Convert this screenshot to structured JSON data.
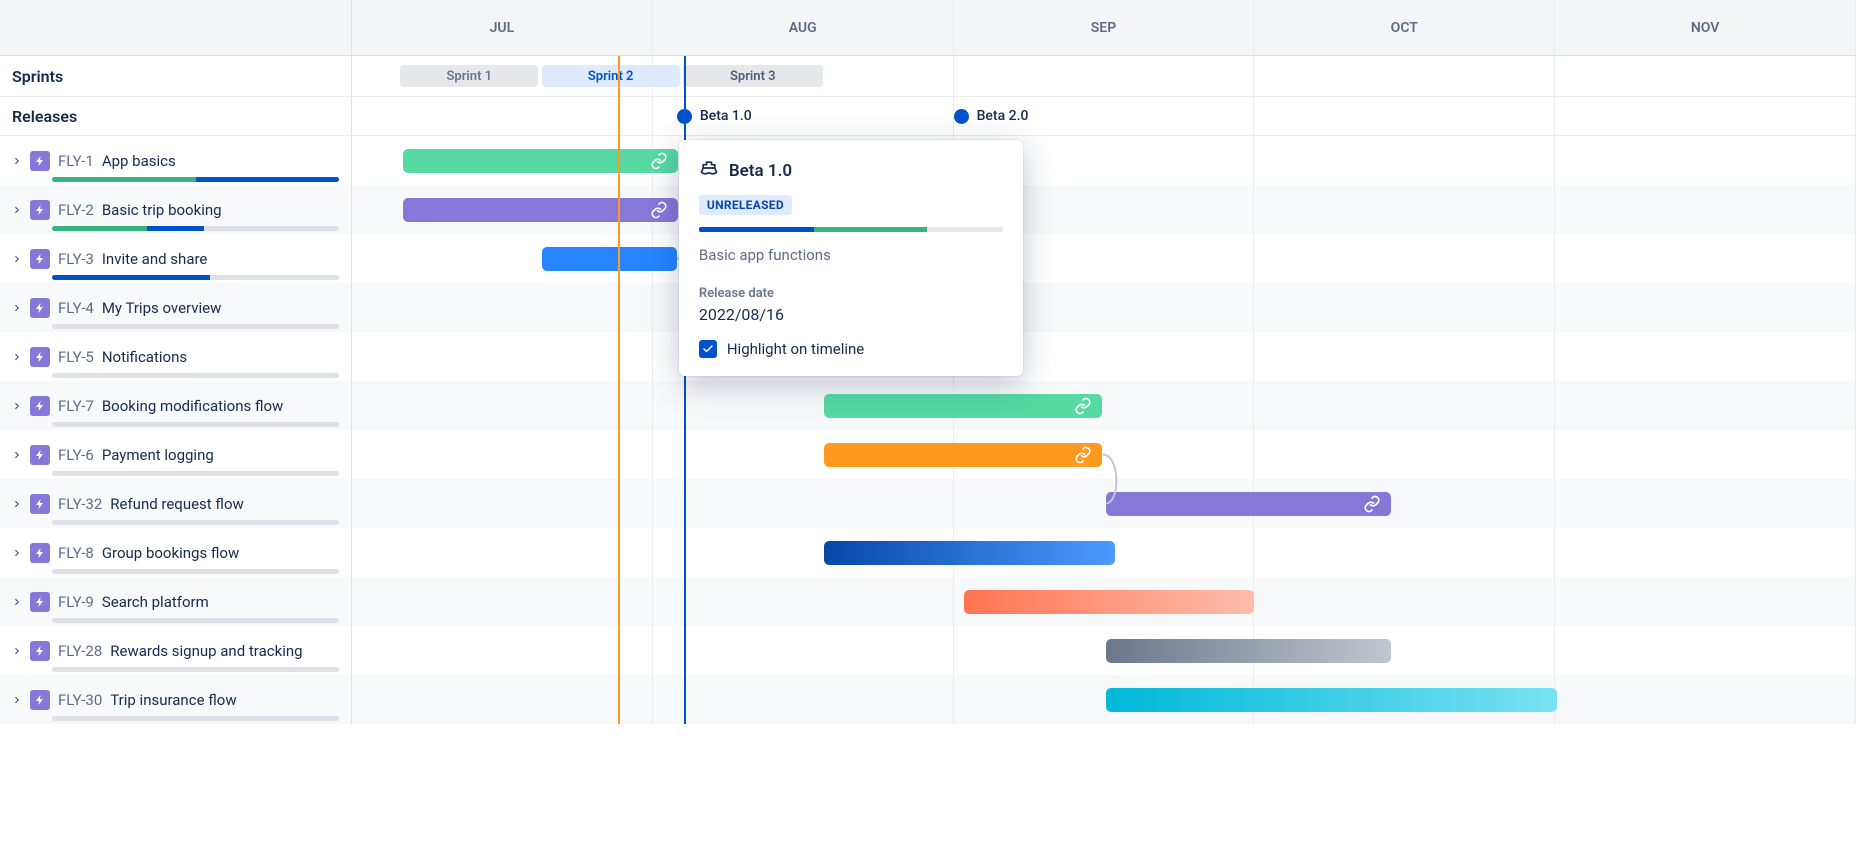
{
  "timeline": {
    "months": [
      "JUL",
      "AUG",
      "SEP",
      "OCT",
      "NOV"
    ]
  },
  "sections": {
    "sprints_label": "Sprints",
    "releases_label": "Releases"
  },
  "sprints": [
    {
      "name": "Sprint 1",
      "left_pct": 3.2,
      "width_pct": 9.2,
      "bg": "#E6E8EB",
      "color": "#6B778C"
    },
    {
      "name": "Sprint 2",
      "left_pct": 12.6,
      "width_pct": 9.2,
      "bg": "#DEEBFF",
      "color": "#0052CC"
    },
    {
      "name": "Sprint 3",
      "left_pct": 22.0,
      "width_pct": 9.3,
      "bg": "#E6E8EB",
      "color": "#505F79"
    }
  ],
  "releases": [
    {
      "name": "Beta 1.0",
      "left_pct": 21.6
    },
    {
      "name": "Beta 2.0",
      "left_pct": 40.0
    }
  ],
  "issues": [
    {
      "key": "FLY-1",
      "title": "App basics",
      "progress": [
        [
          "#36B37E",
          50
        ],
        [
          "#0052CC",
          50
        ]
      ],
      "bar": {
        "left_pct": 3.4,
        "width_pct": 18.3,
        "color": "#57D9A3",
        "link": true
      }
    },
    {
      "key": "FLY-2",
      "title": "Basic trip booking",
      "progress": [
        [
          "#36B37E",
          33
        ],
        [
          "#0052CC",
          20
        ],
        [
          "#DFE1E6",
          47
        ]
      ],
      "bar": {
        "left_pct": 3.4,
        "width_pct": 18.3,
        "color": "#8777D9",
        "link": true
      }
    },
    {
      "key": "FLY-3",
      "title": "Invite and share",
      "progress": [
        [
          "#0052CC",
          55
        ],
        [
          "#DFE1E6",
          45
        ]
      ],
      "bar": {
        "left_pct": 12.6,
        "width_pct": 9.0,
        "color": "#2684FF"
      }
    },
    {
      "key": "FLY-4",
      "title": "My Trips overview",
      "progress": [
        [
          "#DFE1E6",
          100
        ]
      ]
    },
    {
      "key": "FLY-5",
      "title": "Notifications",
      "progress": [
        [
          "#DFE1E6",
          100
        ]
      ]
    },
    {
      "key": "FLY-7",
      "title": "Booking modifications flow",
      "progress": [
        [
          "#DFE1E6",
          100
        ]
      ],
      "bar": {
        "left_pct": 31.4,
        "width_pct": 18.5,
        "color": "#57D9A3",
        "link": true
      }
    },
    {
      "key": "FLY-6",
      "title": "Payment logging",
      "progress": [
        [
          "#DFE1E6",
          100
        ]
      ],
      "bar": {
        "left_pct": 31.4,
        "width_pct": 18.5,
        "color": "#FF991F",
        "link": true
      }
    },
    {
      "key": "FLY-32",
      "title": "Refund request flow",
      "progress": [
        [
          "#DFE1E6",
          100
        ]
      ],
      "bar": {
        "left_pct": 50.1,
        "width_pct": 19.0,
        "color": "#8777D9",
        "link": true
      }
    },
    {
      "key": "FLY-8",
      "title": "Group bookings flow",
      "progress": [
        [
          "#DFE1E6",
          100
        ]
      ],
      "bar": {
        "left_pct": 31.4,
        "width_pct": 19.3,
        "gradient": [
          "#0747A6",
          "#4C9AFF"
        ]
      }
    },
    {
      "key": "FLY-9",
      "title": "Search platform",
      "progress": [
        [
          "#DFE1E6",
          100
        ]
      ],
      "bar": {
        "left_pct": 40.7,
        "width_pct": 19.3,
        "gradient": [
          "#FF7452",
          "#FFBDAD"
        ]
      }
    },
    {
      "key": "FLY-28",
      "title": "Rewards signup and tracking",
      "progress": [
        [
          "#DFE1E6",
          100
        ]
      ],
      "bar": {
        "left_pct": 50.1,
        "width_pct": 19.0,
        "gradient": [
          "#6B778C",
          "#C1C7D0"
        ]
      }
    },
    {
      "key": "FLY-30",
      "title": "Trip insurance flow",
      "progress": [
        [
          "#DFE1E6",
          100
        ]
      ],
      "bar": {
        "left_pct": 50.1,
        "width_pct": 30.0,
        "gradient": [
          "#00B8D9",
          "#79E2F2"
        ]
      }
    }
  ],
  "stage_lines": {
    "orange_left_pct": 17.7,
    "blue_left_pct": 22.1
  },
  "popover": {
    "title": "Beta 1.0",
    "status": "UNRELEASED",
    "progress": [
      [
        "#0052CC",
        38
      ],
      [
        "#36B37E",
        37
      ],
      [
        "#E6E8EB",
        25
      ]
    ],
    "description": "Basic app functions",
    "release_date_label": "Release date",
    "release_date": "2022/08/16",
    "highlight_label": "Highlight on timeline",
    "highlight_checked": true
  }
}
